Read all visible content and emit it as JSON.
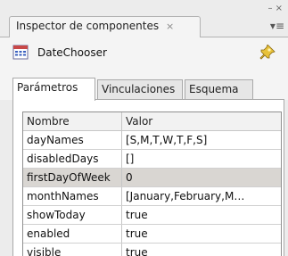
{
  "panel": {
    "title": "Inspector de componentes",
    "close_glyph": "×",
    "minimize_glyph": "– ×",
    "menu_glyph": "▾≡"
  },
  "component": {
    "name": "DateChooser",
    "icon": "calendar-icon",
    "pin_icon": "pin-icon"
  },
  "tabs": [
    {
      "label": "Parámetros",
      "active": true
    },
    {
      "label": "Vinculaciones",
      "active": false
    },
    {
      "label": "Esquema",
      "active": false
    }
  ],
  "grid": {
    "columns": [
      "Nombre",
      "Valor"
    ],
    "rows": [
      {
        "name": "dayNames",
        "value": "[S,M,T,W,T,F,S]"
      },
      {
        "name": "disabledDays",
        "value": "[]"
      },
      {
        "name": "firstDayOfWeek",
        "value": "0",
        "selected": true
      },
      {
        "name": "monthNames",
        "value": "[January,February,M…"
      },
      {
        "name": "showToday",
        "value": "true"
      },
      {
        "name": "enabled",
        "value": "true"
      },
      {
        "name": "visible",
        "value": "true"
      }
    ]
  }
}
